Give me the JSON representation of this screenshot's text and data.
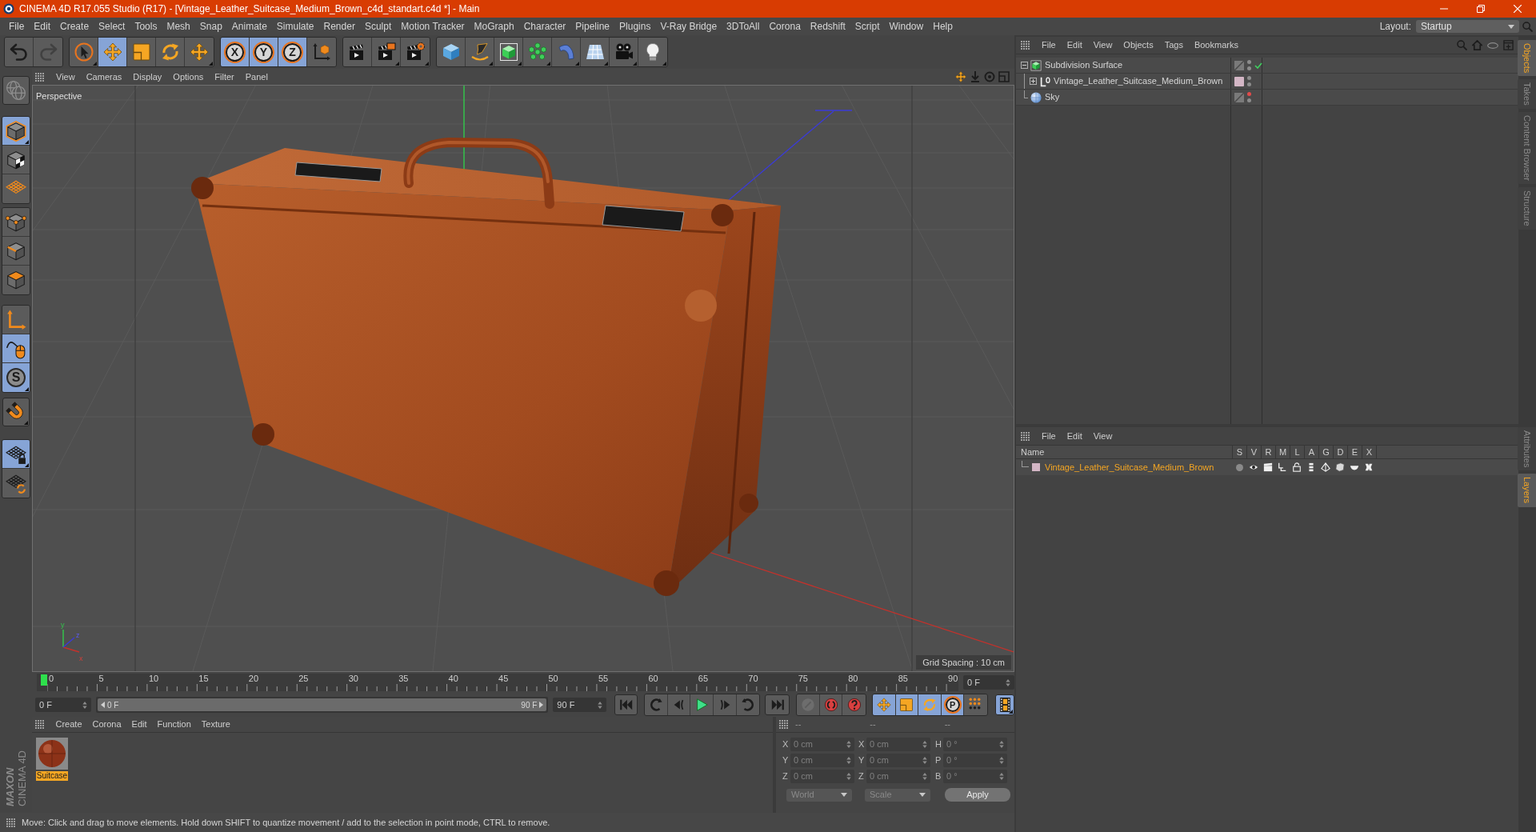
{
  "window": {
    "title": "CINEMA 4D R17.055 Studio (R17) - [Vintage_Leather_Suitcase_Medium_Brown_c4d_standart.c4d *] - Main"
  },
  "menu_bar": {
    "items": [
      "File",
      "Edit",
      "Create",
      "Select",
      "Tools",
      "Mesh",
      "Snap",
      "Animate",
      "Simulate",
      "Render",
      "Sculpt",
      "Motion Tracker",
      "MoGraph",
      "Character",
      "Pipeline",
      "Plugins",
      "V-Ray Bridge",
      "3DToAll",
      "Corona",
      "Redshift",
      "Script",
      "Window",
      "Help"
    ],
    "layout_label": "Layout:",
    "layout_value": "Startup"
  },
  "toolbar": {
    "history": [
      {
        "kind": "undo",
        "disabled": false
      },
      {
        "kind": "redo",
        "disabled": true
      }
    ],
    "tools": [
      {
        "kind": "live-select",
        "selected": false
      },
      {
        "kind": "move",
        "selected": true
      },
      {
        "kind": "scale",
        "selected": false
      },
      {
        "kind": "rotate",
        "selected": false
      },
      {
        "kind": "transform",
        "selected": false
      }
    ],
    "axes": [
      {
        "kind": "axis",
        "label": "X",
        "selected": true
      },
      {
        "kind": "axis",
        "label": "Y",
        "selected": true
      },
      {
        "kind": "axis",
        "label": "Z",
        "selected": true
      },
      {
        "kind": "coord-system",
        "selected": false
      }
    ],
    "render": [
      {
        "kind": "render-view"
      },
      {
        "kind": "render-picture"
      },
      {
        "kind": "render-settings"
      }
    ],
    "create": [
      {
        "kind": "cube"
      },
      {
        "kind": "pen"
      },
      {
        "kind": "subdivision"
      },
      {
        "kind": "cloner"
      },
      {
        "kind": "bend"
      },
      {
        "kind": "floor"
      },
      {
        "kind": "camera"
      },
      {
        "kind": "light"
      }
    ]
  },
  "mode_bar": {
    "groups": [
      [
        {
          "kind": "solo",
          "selected": false
        }
      ],
      [
        {
          "kind": "model",
          "selected": true
        },
        {
          "kind": "texture",
          "selected": false
        },
        {
          "kind": "workplane",
          "selected": false
        }
      ],
      [
        {
          "kind": "points",
          "selected": false
        },
        {
          "kind": "edges",
          "selected": false
        },
        {
          "kind": "polygons",
          "selected": false
        }
      ],
      [
        {
          "kind": "axis-mode",
          "selected": false
        },
        {
          "kind": "tweak",
          "selected": true
        },
        {
          "kind": "snap",
          "label": "S",
          "selected": true
        }
      ],
      [
        {
          "kind": "magnet",
          "selected": false
        }
      ],
      [
        {
          "kind": "lock-workplane",
          "selected": true
        },
        {
          "kind": "planar-workplane",
          "selected": false
        }
      ]
    ],
    "logo": {
      "brand": "MAXON",
      "product": "CINEMA 4D"
    }
  },
  "viewport": {
    "menu": [
      "View",
      "Cameras",
      "Display",
      "Options",
      "Filter",
      "Panel"
    ],
    "camera": "Perspective",
    "grid_spacing": "Grid Spacing : 10 cm",
    "axis_labels": [
      "y",
      "z",
      "x"
    ]
  },
  "timeline": {
    "ticks": [
      "0",
      "5",
      "10",
      "15",
      "20",
      "25",
      "30",
      "35",
      "40",
      "45",
      "50",
      "55",
      "60",
      "65",
      "70",
      "75",
      "80",
      "85",
      "90"
    ],
    "level": 0,
    "current_frame": "0 F"
  },
  "transport": {
    "start_frame": "0 F",
    "range": {
      "start": "0 F",
      "end": "90 F",
      "level": 1
    },
    "end_frame": "90 F",
    "playback": [
      {
        "kind": "go-start"
      },
      {
        "kind": "prev-key"
      },
      {
        "kind": "prev-frame"
      },
      {
        "kind": "play"
      },
      {
        "kind": "next-frame"
      },
      {
        "kind": "next-key"
      },
      {
        "kind": "go-end"
      }
    ],
    "record": [
      {
        "kind": "key",
        "disabled": true
      },
      {
        "kind": "record",
        "disabled": false
      },
      {
        "kind": "autokey",
        "disabled": false
      }
    ],
    "keys": [
      {
        "kind": "move",
        "selected": true
      },
      {
        "kind": "scale",
        "selected": true
      },
      {
        "kind": "rotate",
        "selected": true
      },
      {
        "kind": "param",
        "label": "P",
        "selected": true
      },
      {
        "kind": "grid",
        "selected": false
      }
    ],
    "timeline_window": {
      "selected": true
    }
  },
  "material_manager": {
    "menu": [
      "Create",
      "Corona",
      "Edit",
      "Function",
      "Texture"
    ],
    "materials": [
      {
        "name": "Suitcase",
        "selected": true
      }
    ]
  },
  "coordinates": {
    "headers": [
      "--",
      "--",
      "--"
    ],
    "rows": [
      [
        {
          "axis": "X",
          "value": "0 cm"
        },
        {
          "axis": "X",
          "value": "0 cm"
        },
        {
          "axis": "H",
          "value": "0 °"
        }
      ],
      [
        {
          "axis": "Y",
          "value": "0 cm"
        },
        {
          "axis": "Y",
          "value": "0 cm"
        },
        {
          "axis": "P",
          "value": "0 °"
        }
      ],
      [
        {
          "axis": "Z",
          "value": "0 cm"
        },
        {
          "axis": "Z",
          "value": "0 cm"
        },
        {
          "axis": "B",
          "value": "0 °"
        }
      ]
    ],
    "dropdowns": [
      "World",
      "Scale"
    ],
    "apply": "Apply"
  },
  "status_bar": "Move: Click and drag to move elements. Hold down SHIFT to quantize movement / add to the selection in point mode, CTRL to remove.",
  "object_manager": {
    "menu": [
      "File",
      "Edit",
      "View",
      "Objects",
      "Tags",
      "Bookmarks"
    ],
    "objects": [
      {
        "name": "Subdivision Surface",
        "kind": "subdivision",
        "expanded": true,
        "editor_hidden": false,
        "render_hidden": false,
        "enabled_check": true,
        "children": [
          {
            "name": "Vintage_Leather_Suitcase_Medium_Brown",
            "kind": "null",
            "expanded": false,
            "color": "#d3b6c5",
            "editor_hidden": false,
            "render_hidden": false,
            "enabled_check": false
          }
        ]
      },
      {
        "name": "Sky",
        "kind": "sky",
        "editor_hidden": true,
        "render_hidden": false,
        "enabled_check": false
      }
    ]
  },
  "layer_manager": {
    "menu": [
      "File",
      "Edit",
      "View"
    ],
    "columns": [
      "Name",
      "S",
      "V",
      "R",
      "M",
      "L",
      "A",
      "G",
      "D",
      "E",
      "X"
    ],
    "layers": [
      {
        "name": "Vintage_Leather_Suitcase_Medium_Brown",
        "color": "#d3b6c5",
        "selected": true,
        "solo": false
      }
    ]
  },
  "side_tabs": {
    "top": [
      {
        "label": "Objects",
        "selected": true
      },
      {
        "label": "Takes",
        "selected": false
      },
      {
        "label": "Content Browser",
        "selected": false
      },
      {
        "label": "Structure",
        "selected": false
      }
    ],
    "bottom": [
      {
        "label": "Attributes",
        "selected": false
      },
      {
        "label": "Layers",
        "selected": true
      }
    ]
  }
}
